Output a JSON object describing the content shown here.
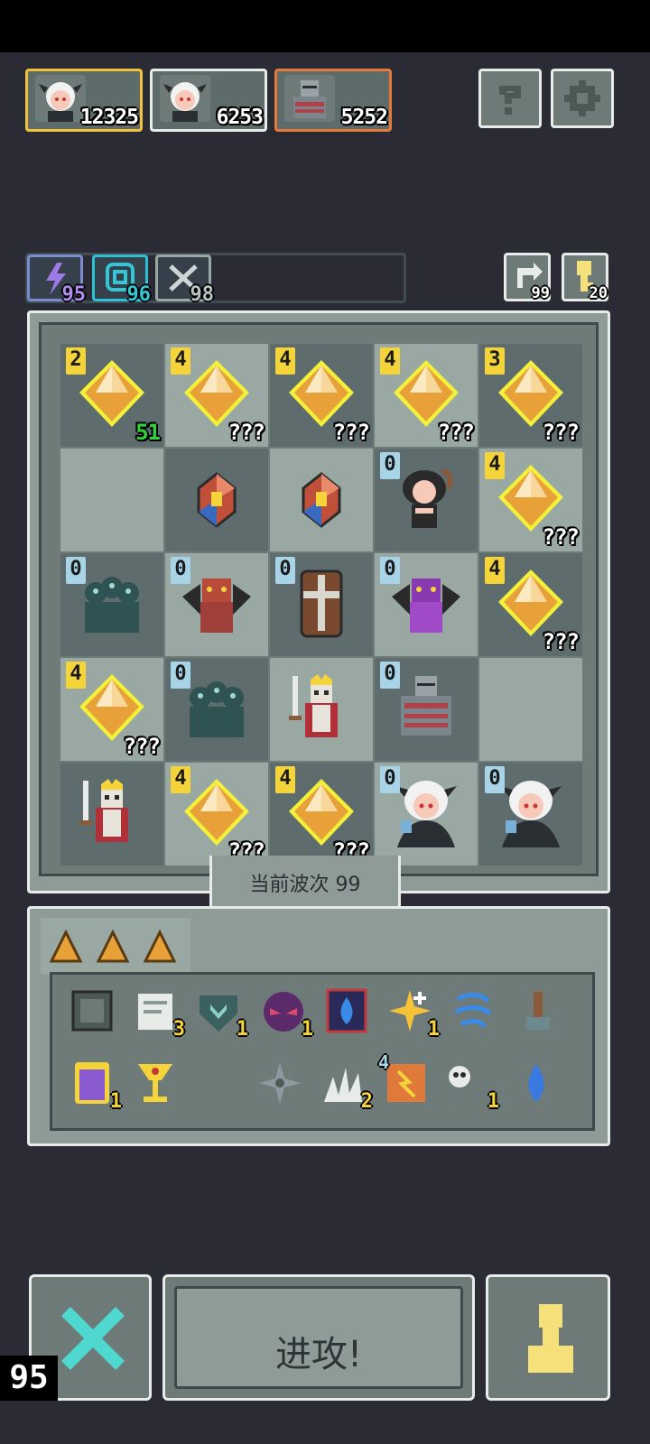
{
  "enemies": [
    {
      "name": "white-haired-girl-enemy",
      "score": "12325",
      "border": "#f2c33a"
    },
    {
      "name": "white-haired-girl-enemy",
      "score": "6253",
      "border": "#e8ece8"
    },
    {
      "name": "armored-knight-enemy",
      "score": "5252",
      "border": "#e47a3a"
    }
  ],
  "buttons": {
    "help": "?",
    "settings": "gear"
  },
  "resources": [
    {
      "icon": "lightning-icon",
      "value": "95",
      "color": "#b48cf0"
    },
    {
      "icon": "spiral-icon",
      "value": "96",
      "color": "#33c6d6"
    },
    {
      "icon": "crossed-swords-icon",
      "value": "98",
      "color": "#b9c4c2"
    }
  ],
  "stats": [
    {
      "icon": "refresh-icon",
      "value": "99"
    },
    {
      "icon": "key-icon",
      "value": "20"
    }
  ],
  "board": [
    [
      {
        "type": "crystal",
        "tier": "2",
        "qty": "51",
        "qtyColor": "green"
      },
      {
        "type": "crystal",
        "tier": "4",
        "qty": "???"
      },
      {
        "type": "crystal",
        "tier": "4",
        "qty": "???"
      },
      {
        "type": "crystal",
        "tier": "4",
        "qty": "???"
      },
      {
        "type": "crystal",
        "tier": "3",
        "qty": "???"
      }
    ],
    [
      {
        "type": "empty"
      },
      {
        "type": "gem"
      },
      {
        "type": "gem"
      },
      {
        "type": "dark-haired-girl",
        "tier": "0"
      },
      {
        "type": "crystal",
        "tier": "4",
        "qty": "???"
      }
    ],
    [
      {
        "type": "hydra",
        "tier": "0"
      },
      {
        "type": "red-dragon",
        "tier": "0"
      },
      {
        "type": "coffin",
        "tier": "0"
      },
      {
        "type": "purple-dragon",
        "tier": "0"
      },
      {
        "type": "crystal",
        "tier": "4",
        "qty": "???"
      }
    ],
    [
      {
        "type": "crystal",
        "tier": "4",
        "qty": "???"
      },
      {
        "type": "hydra",
        "tier": "0"
      },
      {
        "type": "skeleton-king"
      },
      {
        "type": "armored-knight",
        "tier": "0"
      },
      {
        "type": "empty"
      }
    ],
    [
      {
        "type": "skeleton-king"
      },
      {
        "type": "crystal",
        "tier": "4",
        "qty": "???"
      },
      {
        "type": "crystal",
        "tier": "4",
        "qty": "???"
      },
      {
        "type": "white-haired-girl",
        "tier": "0"
      },
      {
        "type": "white-haired-girl",
        "tier": "0"
      }
    ]
  ],
  "wave": {
    "label": "当前波次 99"
  },
  "inventory": {
    "row1": [
      {
        "icon": "stone-block-icon",
        "count": ""
      },
      {
        "icon": "scroll-icon",
        "count": "3"
      },
      {
        "icon": "heart-shield-icon",
        "count": "1"
      },
      {
        "icon": "demon-mask-icon",
        "count": "1"
      },
      {
        "icon": "water-drop-book-icon",
        "count": ""
      },
      {
        "icon": "sparkle-burst-icon",
        "count": "1"
      },
      {
        "icon": "blue-wind-icon",
        "count": ""
      },
      {
        "icon": "hammer-icon",
        "count": ""
      }
    ],
    "row2": [
      {
        "icon": "potion-jar-icon",
        "count": "1"
      },
      {
        "icon": "goblet-icon",
        "count": ""
      },
      {
        "icon": "shuriken-icon",
        "count": ""
      },
      {
        "icon": "claw-icon",
        "count": "2"
      },
      {
        "icon": "fire-scroll-icon",
        "count": "",
        "level": "4"
      },
      {
        "icon": "skull-beast-icon",
        "count": "1"
      },
      {
        "icon": "blue-drop-icon",
        "count": ""
      }
    ]
  },
  "actions": {
    "attack": "进攻!"
  },
  "counter": "95"
}
